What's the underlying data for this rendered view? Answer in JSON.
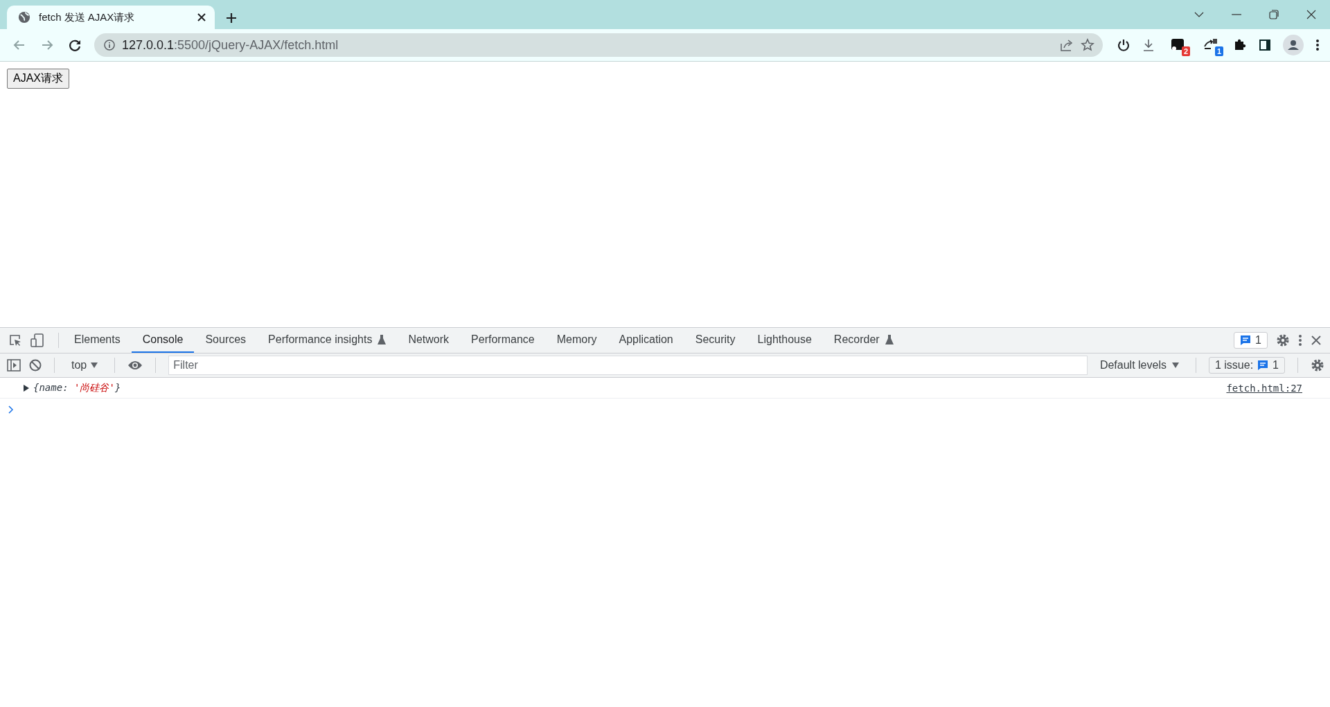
{
  "browser_tab": {
    "title": "fetch 发送 AJAX请求"
  },
  "address_bar": {
    "host": "127.0.0.1",
    "path": ":5500/jQuery-AJAX/fetch.html"
  },
  "extensions": [
    {
      "kind": "app",
      "badge": "2",
      "color": "#e53935"
    },
    {
      "kind": "translate",
      "badge": "1",
      "color": "#1a73e8"
    }
  ],
  "page": {
    "button": "AJAX请求"
  },
  "devtools": {
    "tabs": [
      {
        "label": "Elements",
        "selected": false,
        "experimental": false
      },
      {
        "label": "Console",
        "selected": true,
        "experimental": false
      },
      {
        "label": "Sources",
        "selected": false,
        "experimental": false
      },
      {
        "label": "Performance insights",
        "selected": false,
        "experimental": true
      },
      {
        "label": "Network",
        "selected": false,
        "experimental": false
      },
      {
        "label": "Performance",
        "selected": false,
        "experimental": false
      },
      {
        "label": "Memory",
        "selected": false,
        "experimental": false
      },
      {
        "label": "Application",
        "selected": false,
        "experimental": false
      },
      {
        "label": "Security",
        "selected": false,
        "experimental": false
      },
      {
        "label": "Lighthouse",
        "selected": false,
        "experimental": false
      },
      {
        "label": "Recorder",
        "selected": false,
        "experimental": true
      }
    ],
    "message_count": "1",
    "console_toolbar": {
      "context": "top",
      "filter": {
        "placeholder": "Filter"
      },
      "levels": "Default levels",
      "issues_label": "1 issue:",
      "issues_count": "1"
    },
    "log": [
      {
        "expanded": false,
        "preview": [
          {
            "kind": "punct",
            "text": "{name: "
          },
          {
            "kind": "string",
            "text": "'尚硅谷'"
          },
          {
            "kind": "punct",
            "text": "}"
          }
        ],
        "source": "fetch.html:27"
      }
    ]
  }
}
